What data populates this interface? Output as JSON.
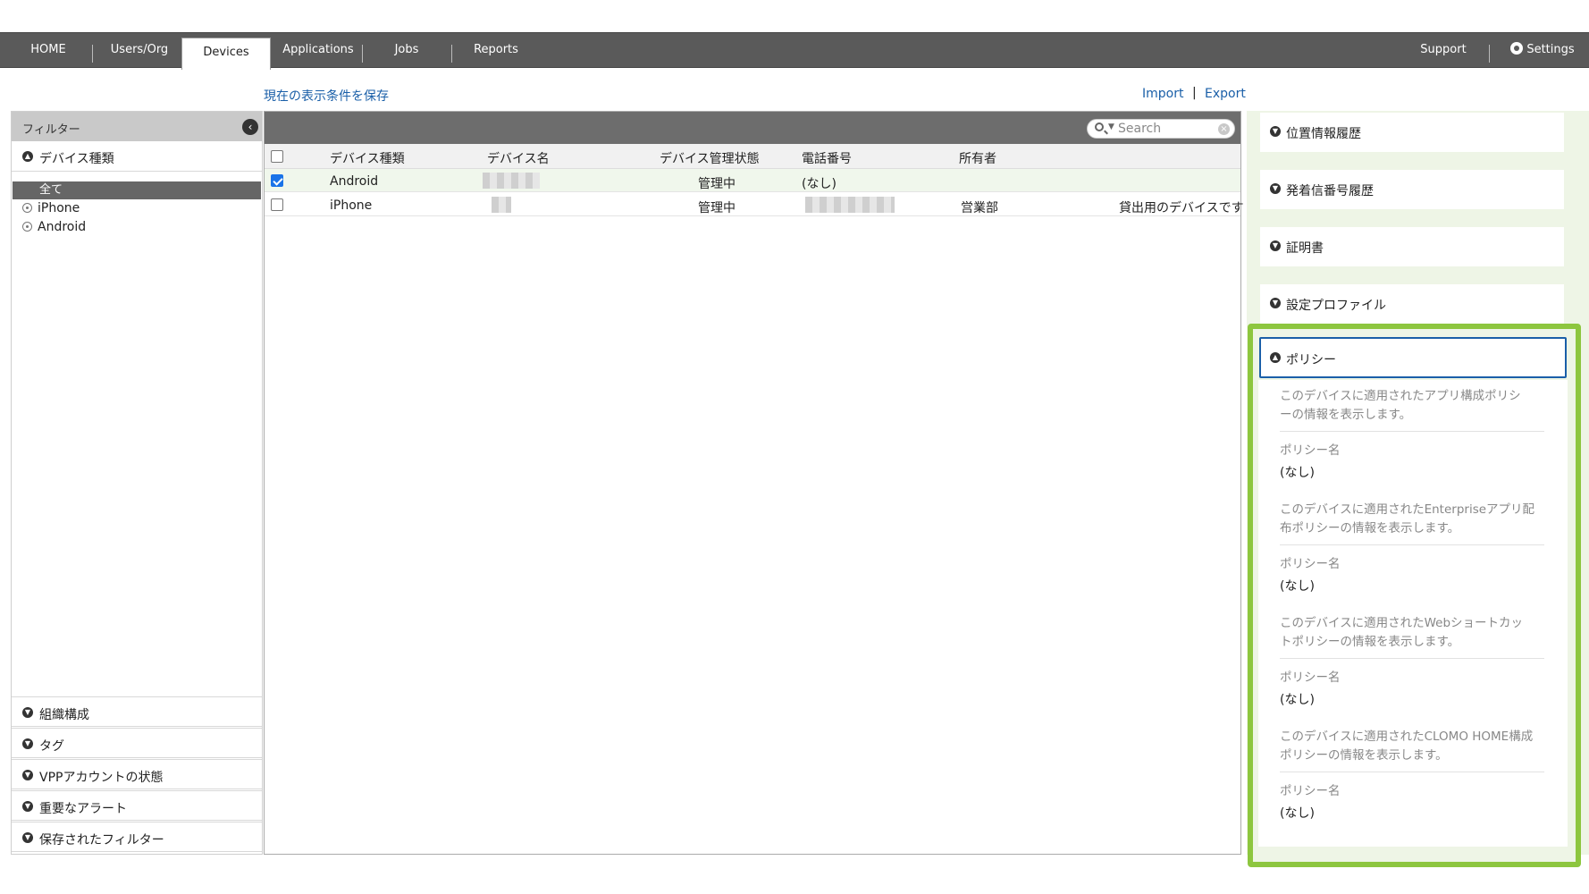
{
  "nav": {
    "home": "HOME",
    "users": "Users/Org",
    "devices": "Devices",
    "applications": "Applications",
    "jobs": "Jobs",
    "reports": "Reports",
    "support": "Support",
    "settings": "Settings"
  },
  "actions": {
    "save_view": "現在の表示条件を保存",
    "import": "Import",
    "separator": "|",
    "export": "Export"
  },
  "filter": {
    "title": "フィルター",
    "device_type": "デバイス種類",
    "options": [
      "全て",
      "iPhone",
      "Android"
    ],
    "sections": [
      "組織構成",
      "タグ",
      "VPPアカウントの状態",
      "重要なアラート",
      "保存されたフィルター"
    ]
  },
  "table": {
    "search_placeholder": "Search",
    "headers": {
      "type": "デバイス種類",
      "name": "デバイス名",
      "status": "デバイス管理状態",
      "phone": "電話番号",
      "owner": "所有者"
    },
    "rows": [
      {
        "checked": true,
        "type": "Android",
        "status": "管理中",
        "phone": "(なし)",
        "owner": "",
        "note": ""
      },
      {
        "checked": false,
        "type": "iPhone",
        "status": "管理中",
        "phone": "",
        "owner": "営業部",
        "note": "貸出用のデバイスです"
      }
    ]
  },
  "right": {
    "sections": [
      "位置情報履歴",
      "発着信番号履歴",
      "証明書",
      "設定プロファイル"
    ],
    "policy": {
      "title": "ポリシー",
      "blocks": [
        {
          "desc1": "このデバイスに適用されたアプリ構成ポリシ",
          "desc2": "ーの情報を表示します。",
          "label": "ポリシー名",
          "value": "(なし)"
        },
        {
          "desc1": "このデバイスに適用されたEnterpriseアプリ配",
          "desc2": "布ポリシーの情報を表示します。",
          "label": "ポリシー名",
          "value": "(なし)"
        },
        {
          "desc1": "このデバイスに適用されたWebショートカッ",
          "desc2": "トポリシーの情報を表示します。",
          "label": "ポリシー名",
          "value": "(なし)"
        },
        {
          "desc1": "このデバイスに適用されたCLOMO HOME構成",
          "desc2": "ポリシーの情報を表示します。",
          "label": "ポリシー名",
          "value": "(なし)"
        }
      ]
    }
  },
  "colors": {
    "nav_bg": "#5a5a5a",
    "link": "#1a5fa8",
    "highlight": "#8dc63f",
    "checkbox": "#1a73e8"
  }
}
